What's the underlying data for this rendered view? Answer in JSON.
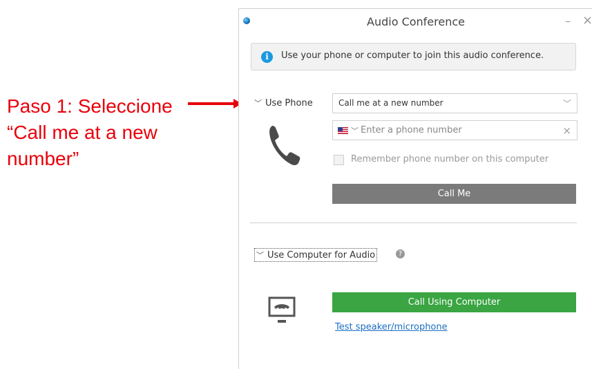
{
  "annotation": {
    "step1_text": "Paso 1: Seleccione “Call me at a new number”",
    "color": "#e8000b"
  },
  "window": {
    "title": "Audio Conference",
    "minimize_glyph": "–",
    "close_glyph": "×"
  },
  "info_banner": {
    "icon": "info-icon",
    "text": "Use your phone or computer to join this audio conference."
  },
  "phone_section": {
    "label": "Use Phone",
    "dropdown_value": "Call me at a new number",
    "phone_placeholder": "Enter a phone number",
    "remember_label": "Remember phone number on this computer",
    "call_me_label": "Call Me",
    "call_me_color": "#7b7b7b"
  },
  "computer_section": {
    "label": "Use Computer for Audio",
    "call_label": "Call Using Computer",
    "call_color": "#3aa542",
    "test_link": "Test speaker/microphone"
  }
}
